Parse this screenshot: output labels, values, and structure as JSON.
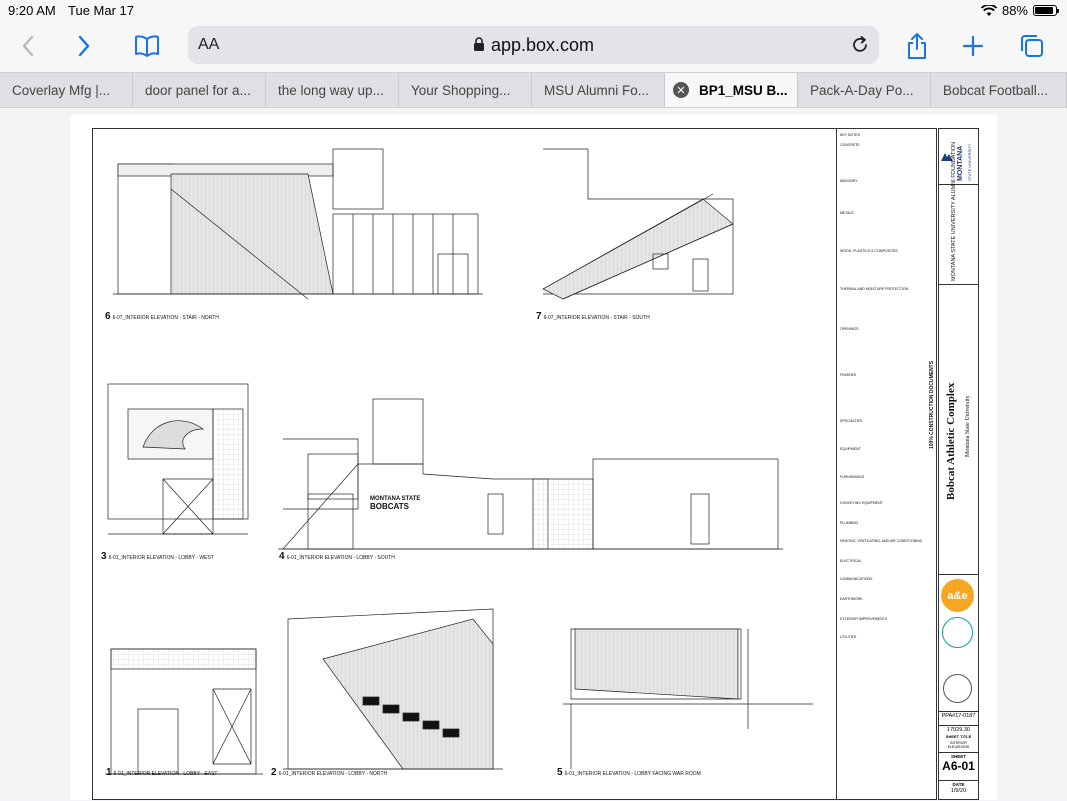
{
  "status_bar": {
    "time": "9:20 AM",
    "date": "Tue Mar 17",
    "battery": "88%",
    "battery_level": 0.88
  },
  "toolbar": {
    "text_size_label": "AA",
    "url": "app.box.com"
  },
  "tabs": [
    {
      "label": "Coverlay Mfg |..."
    },
    {
      "label": "door panel for a..."
    },
    {
      "label": "the long way up..."
    },
    {
      "label": "Your Shopping..."
    },
    {
      "label": "MSU Alumni Fo..."
    },
    {
      "label": "BP1_MSU B...",
      "active": true
    },
    {
      "label": "Pack-A-Day Po..."
    },
    {
      "label": "Bobcat Football..."
    }
  ],
  "drawing": {
    "views": [
      {
        "num": "6",
        "title": "6-07_INTERIOR ELEVATION - STAIR - NORTH"
      },
      {
        "num": "7",
        "title": "6-07_INTERIOR ELEVATION - STAIR - SOUTH"
      },
      {
        "num": "3",
        "title": "6-01_INTERIOR ELEVATION - LOBBY - WEST"
      },
      {
        "num": "4",
        "title": "6-01_INTERIOR ELEVATION - LOBBY - SOUTH"
      },
      {
        "num": "1",
        "title": "6-01_INTERIOR ELEVATION - LOBBY - EAST"
      },
      {
        "num": "2",
        "title": "6-01_INTERIOR ELEVATION - LOBBY - NORTH"
      },
      {
        "num": "5",
        "title": "6-01_INTERIOR ELEVATION - LOBBY FACING WAR ROOM"
      }
    ],
    "signage": {
      "line1": "MONTANA STATE",
      "line2": "BOBCATS"
    },
    "spec_sections": [
      "KEY NOTES",
      "CONCRETE",
      "MASONRY",
      "METALS",
      "WOOD, PLASTICS & COMPOSITES",
      "THERMAL AND MOISTURE PROTECTION",
      "OPENINGS",
      "FINISHES",
      "SPECIALTIES",
      "EQUIPMENT",
      "FURNISHINGS",
      "CONVEYING EQUIPMENT",
      "PLUMBING",
      "HEATING, VENTILATING, AND AIR CONDITIONING",
      "ELECTRICAL",
      "COMMUNICATIONS",
      "EARTHWORK",
      "EXTERIOR IMPROVEMENTS",
      "UTILITIES"
    ],
    "title_block": {
      "university_line1": "MONTANA",
      "university_line2": "STATE UNIVERSITY",
      "foundation": "MONTANA STATE UNIVERSITY ALUMNI FOUNDATION",
      "doc_type": "100% CONSTRUCTION DOCUMENTS",
      "project_name": "Bobcat Athletic Complex",
      "client": "Montana State University",
      "architect_logo": "a&e",
      "ppa": "PPA#17-0187",
      "project_no": "17029.30",
      "sheet_title_label": "SHEET TITLE",
      "sheet_title": "INTERIOR ELEVATIONS",
      "sheet_label": "SHEET",
      "sheet_no": "A6-01",
      "date_label": "DATE",
      "date": "1/9/20"
    }
  }
}
